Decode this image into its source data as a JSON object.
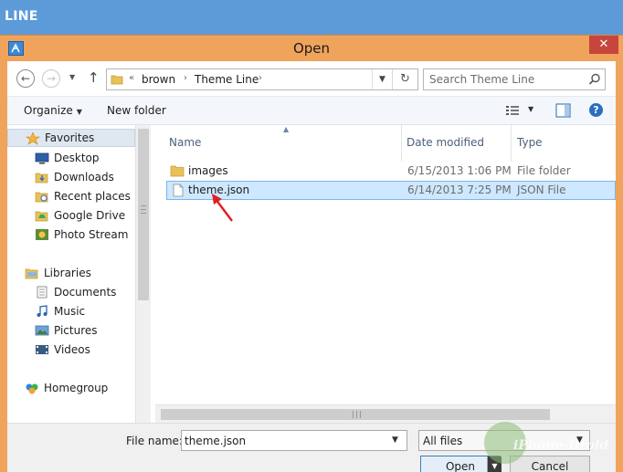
{
  "app": {
    "title": "LINE"
  },
  "dialog": {
    "title": "Open",
    "close_glyph": "✕"
  },
  "navigation": {
    "back_glyph": "←",
    "forward_glyph": "→",
    "recent_glyph": "▼",
    "up_glyph": "↑",
    "breadcrumb": {
      "overflow": "«",
      "items": [
        "brown",
        "Theme Line"
      ],
      "separator": "›"
    },
    "refresh_glyph": "↻",
    "search_placeholder": "Search Theme Line"
  },
  "commandbar": {
    "organize_label": "Organize",
    "new_folder_label": "New folder",
    "help_glyph": "?"
  },
  "sidebar": {
    "items": [
      {
        "label": "Favorites",
        "icon": "star-icon"
      },
      {
        "label": "Desktop",
        "icon": "desktop-icon"
      },
      {
        "label": "Downloads",
        "icon": "downloads-icon"
      },
      {
        "label": "Recent places",
        "icon": "recent-places-icon"
      },
      {
        "label": "Google Drive",
        "icon": "google-drive-icon"
      },
      {
        "label": "Photo Stream",
        "icon": "photo-stream-icon"
      },
      {
        "label": "Libraries",
        "icon": "libraries-icon"
      },
      {
        "label": "Documents",
        "icon": "documents-icon"
      },
      {
        "label": "Music",
        "icon": "music-icon"
      },
      {
        "label": "Pictures",
        "icon": "pictures-icon"
      },
      {
        "label": "Videos",
        "icon": "videos-icon"
      },
      {
        "label": "Homegroup",
        "icon": "homegroup-icon"
      }
    ]
  },
  "filelist": {
    "columns": [
      "Name",
      "Date modified",
      "Type"
    ],
    "rows": [
      {
        "name": "images",
        "date": "6/15/2013 1:06 PM",
        "type": "File folder",
        "icon": "folder-icon"
      },
      {
        "name": "theme.json",
        "date": "6/14/2013 7:25 PM",
        "type": "JSON File",
        "icon": "file-icon"
      }
    ]
  },
  "footer": {
    "filename_label": "File name:",
    "filename_value": "theme.json",
    "filetype_value": "All files",
    "open_label": "Open",
    "cancel_label": "Cancel"
  },
  "watermark": {
    "text": "iPhone-Droid"
  },
  "colors": {
    "app_titlebar": "#5d9ad8",
    "dialog_frame": "#f0a35a",
    "close_button": "#c7453c",
    "selection": "#cde8ff",
    "annotation_arrow": "#e02020"
  }
}
